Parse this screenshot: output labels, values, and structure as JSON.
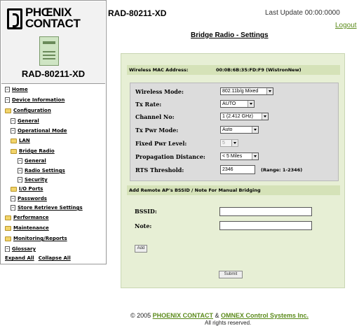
{
  "header": {
    "device_title": "RAD-80211-XD",
    "last_update": "Last Update 00:00:0000",
    "logout_label": "Logout",
    "page_title": "Bridge Radio - Settings"
  },
  "sidebar": {
    "logo_text_line1": "PHŒNIX",
    "logo_text_line2": "CONTACT",
    "device_name": "RAD-80211-XD",
    "items": [
      {
        "label": "Home",
        "icon": "document-icon"
      },
      {
        "label": "Device Information",
        "icon": "document-icon"
      },
      {
        "label": "Configuration",
        "icon": "folder-open-icon"
      },
      {
        "label": "General",
        "icon": "document-icon"
      },
      {
        "label": "Operational Mode",
        "icon": "document-icon"
      },
      {
        "label": "LAN",
        "icon": "folder-icon"
      },
      {
        "label": "Bridge Radio",
        "icon": "folder-open-icon"
      },
      {
        "label": "General",
        "icon": "document-icon"
      },
      {
        "label": "Radio Settings",
        "icon": "document-icon"
      },
      {
        "label": "Security",
        "icon": "document-icon"
      },
      {
        "label": "I/O Ports",
        "icon": "folder-icon"
      },
      {
        "label": "Passwords",
        "icon": "document-icon"
      },
      {
        "label": "Store Retrieve Settings",
        "icon": "document-icon"
      },
      {
        "label": "Performance",
        "icon": "folder-icon"
      },
      {
        "label": "Maintenance",
        "icon": "folder-icon"
      },
      {
        "label": "Monitoring/Reports",
        "icon": "folder-icon"
      },
      {
        "label": "Glossary",
        "icon": "document-icon"
      }
    ],
    "expand_all": "Expand All",
    "collapse_all": "Collapse All"
  },
  "main": {
    "mac_label": "Wireless MAC Address:",
    "mac_value": "00:0B:6B:35:FD:F9  (WistronNew)",
    "fields": {
      "wireless_mode": {
        "label": "Wireless Mode:",
        "value": "802.11b/g Mixed"
      },
      "tx_rate": {
        "label": "Tx Rate:",
        "value": "AUTO"
      },
      "channel": {
        "label": "Channel No:",
        "value": "1 (2.412 GHz)"
      },
      "tx_pwr_mode": {
        "label": "Tx Pwr Mode:",
        "value": "Auto"
      },
      "fixed_pwr": {
        "label": "Fixed Pwr Level:",
        "value": "5"
      },
      "propagation": {
        "label": "Propagation Distance:",
        "value": "< 5 Miles"
      },
      "rts": {
        "label": "RTS Threshold:",
        "value": "2346",
        "hint": "(Range: 1-2346)"
      }
    },
    "remote_header": "Add Remote AP's BSSID / Note For Manual Bridging",
    "bssid_label": "BSSID:",
    "bssid_value": "",
    "note_label": "Note:",
    "note_value": "",
    "add_label": "Add",
    "submit_label": "Submit"
  },
  "footer": {
    "copyright_prefix": "© 2005 ",
    "company1": "PHOENIX CONTACT",
    "amp": " & ",
    "company2": "OMNEX Control Systems Inc.",
    "rights": "All rights reserved."
  },
  "colors": {
    "panel_bg": "#e7efd5",
    "bar_bg": "#d5e2b8",
    "link_green": "#5a8a1a"
  }
}
